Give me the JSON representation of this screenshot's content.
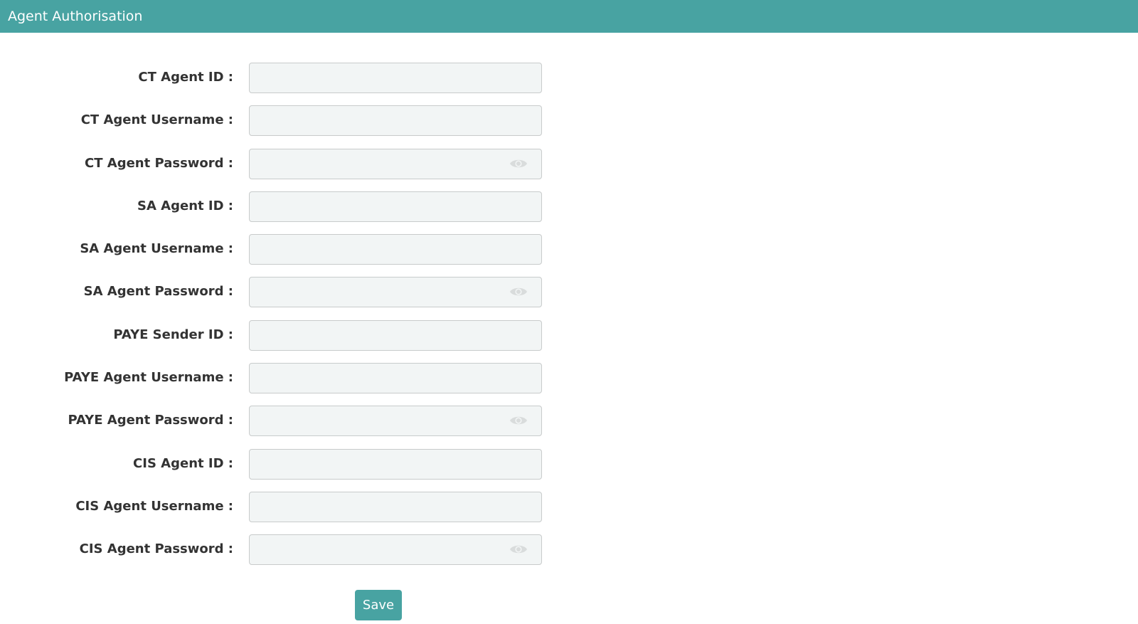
{
  "header": {
    "title": "Agent Authorisation"
  },
  "colors": {
    "accent": "#48a3a2",
    "field_bg": "#f2f5f5",
    "label": "#333333"
  },
  "fields": [
    {
      "label": "CT Agent ID :",
      "value": "",
      "type": "text"
    },
    {
      "label": "CT Agent Username :",
      "value": "",
      "type": "text"
    },
    {
      "label": "CT Agent Password :",
      "value": "",
      "type": "password",
      "icon": "eye-icon"
    },
    {
      "label": "SA Agent ID :",
      "value": "",
      "type": "text"
    },
    {
      "label": "SA Agent Username :",
      "value": "",
      "type": "text"
    },
    {
      "label": "SA Agent Password :",
      "value": "",
      "type": "password",
      "icon": "eye-icon"
    },
    {
      "label": "PAYE Sender ID :",
      "value": "",
      "type": "text"
    },
    {
      "label": "PAYE Agent Username :",
      "value": "",
      "type": "text"
    },
    {
      "label": "PAYE Agent Password :",
      "value": "",
      "type": "password",
      "icon": "eye-icon"
    },
    {
      "label": "CIS Agent ID :",
      "value": "",
      "type": "text"
    },
    {
      "label": "CIS Agent Username :",
      "value": "",
      "type": "text"
    },
    {
      "label": "CIS Agent Password :",
      "value": "",
      "type": "password",
      "icon": "eye-icon"
    }
  ],
  "actions": {
    "save_label": "Save"
  }
}
